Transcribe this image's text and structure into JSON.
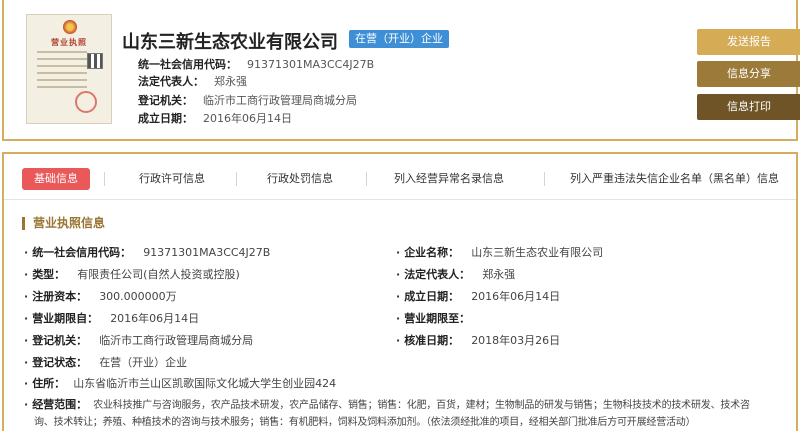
{
  "header": {
    "license_image": {
      "title": "营业执照"
    },
    "company_name": "山东三新生态农业有限公司",
    "status_badge": "在营（开业）企业",
    "rows": [
      {
        "label": "统一社会信用代码：",
        "value": "91371301MA3CC4J27B"
      },
      {
        "label": "法定代表人：",
        "value": "郑永强"
      },
      {
        "label": "登记机关：",
        "value": "临沂市工商行政管理局商城分局"
      },
      {
        "label": "成立日期：",
        "value": "2016年06月14日"
      }
    ],
    "actions": {
      "report": "发送报告",
      "share": "信息分享",
      "print": "信息打印"
    }
  },
  "tabs": [
    {
      "label": "基础信息",
      "active": true
    },
    {
      "label": "行政许可信息",
      "active": false
    },
    {
      "label": "行政处罚信息",
      "active": false
    },
    {
      "label": "列入经营异常名录信息",
      "active": false
    },
    {
      "label": "列入严重违法失信企业名单（黑名单）信息",
      "active": false
    }
  ],
  "section": {
    "title": "营业执照信息",
    "fields": {
      "credit_code": {
        "label": "统一社会信用代码：",
        "value": "91371301MA3CC4J27B"
      },
      "company_name": {
        "label": "企业名称：",
        "value": "山东三新生态农业有限公司"
      },
      "type": {
        "label": "类型：",
        "value": "有限责任公司(自然人投资或控股)"
      },
      "legal_rep": {
        "label": "法定代表人：",
        "value": "郑永强"
      },
      "capital": {
        "label": "注册资本：",
        "value": "300.000000万"
      },
      "established": {
        "label": "成立日期：",
        "value": "2016年06月14日"
      },
      "term_from": {
        "label": "营业期限自：",
        "value": "2016年06月14日"
      },
      "term_to": {
        "label": "营业期限至：",
        "value": ""
      },
      "authority": {
        "label": "登记机关：",
        "value": "临沂市工商行政管理局商城分局"
      },
      "approval_date": {
        "label": "核准日期：",
        "value": "2018年03月26日"
      },
      "reg_status": {
        "label": "登记状态：",
        "value": "在营（开业）企业"
      },
      "address": {
        "label": "住所：",
        "value": "山东省临沂市兰山区凯歌国际文化城大学生创业园424"
      },
      "scope": {
        "label": "经营范围：",
        "value_line1": "农业科技推广与咨询服务，农产品技术研发，农产品储存、销售；销售：化肥，百货，建材；生物制品的研发与销售；生物科技技术的技术研发、技术咨",
        "value_line2": "询、技术转让；养殖、种植技术的咨询与技术服务；销售：有机肥料，饲料及饲料添加剂。（依法须经批准的项目，经相关部门批准后方可开展经营活动）"
      }
    }
  },
  "colors": {
    "gold_border": "#d5ad60",
    "badge_blue": "#3e8fd6",
    "tab_active": "#e9595a",
    "btn_report": "#d5ab55",
    "btn_share": "#9c7b3a",
    "btn_print": "#6e5426"
  }
}
